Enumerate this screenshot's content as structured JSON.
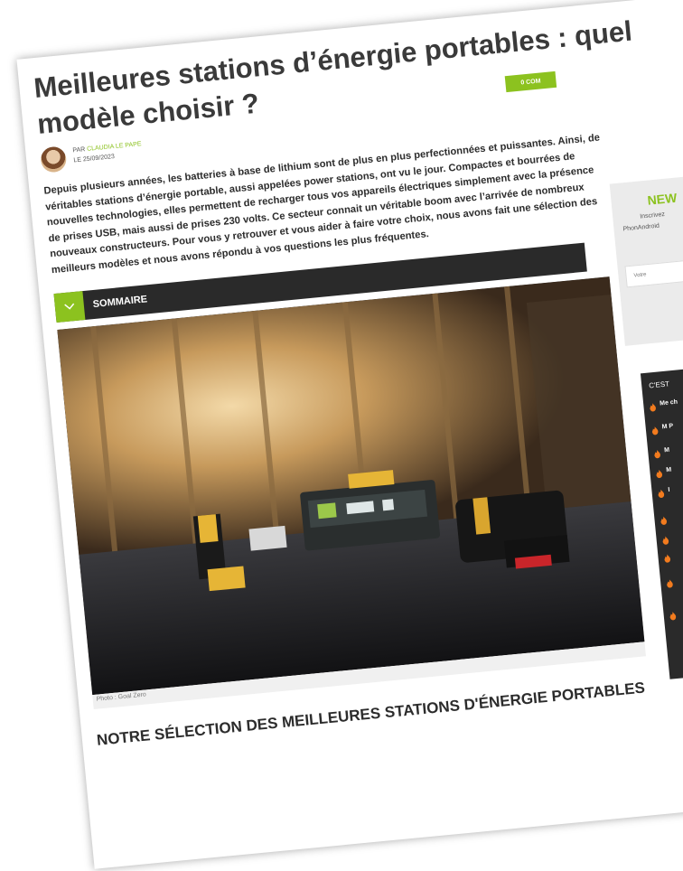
{
  "article": {
    "title": "Meilleures stations d’énergie portables : quel modèle choisir ?",
    "comments_badge": "0 COM",
    "author_prefix": "PAR",
    "author_name": "CLAUDIA LE PAPE",
    "date": "LE 25/09/2023",
    "intro": "Depuis plusieurs années, les batteries à base de lithium sont de plus en plus perfectionnées et puissantes. Ainsi, de véritables stations d’énergie portable, aussi appelées power stations, ont vu le jour. Compactes et bourrées de nouvelles technologies, elles permettent de recharger tous vos appareils électriques simplement avec la présence de prises USB, mais aussi de prises 230 volts. Ce secteur connait un véritable boom avec l’arrivée de nombreux nouveaux constructeurs. Pour vous y retrouver et vous aider à faire votre choix, nous avons fait une sélection des meilleurs modèles et nous avons répondu à vos questions les plus fréquentes.",
    "sommaire_label": "SOMMAIRE",
    "photo_caption": "Photo : Goal Zero",
    "section_title": "NOTRE SÉLECTION DES MEILLEURES STATIONS D'ÉNERGIE PORTABLES"
  },
  "sidebar": {
    "newsletter_title": "NEW",
    "newsletter_text1": "Inscrivez",
    "newsletter_text2": "PhonAndroid",
    "newsletter_placeholder": "Votre",
    "trending_title": "C'EST",
    "trending_items": [
      {
        "text": "Me ch"
      },
      {
        "text": "M P"
      },
      {
        "text": "M"
      },
      {
        "text": "M"
      },
      {
        "text": "I"
      },
      {
        "text": ""
      },
      {
        "text": ""
      },
      {
        "text": ""
      },
      {
        "text": ""
      },
      {
        "text": ""
      }
    ]
  },
  "colors": {
    "accent": "#8cc21f",
    "dark_bar": "#2a2a2a",
    "text": "#2c2c2c"
  },
  "icons": {
    "sommaire": "chevron-down-icon",
    "trending": "flame-icon"
  }
}
